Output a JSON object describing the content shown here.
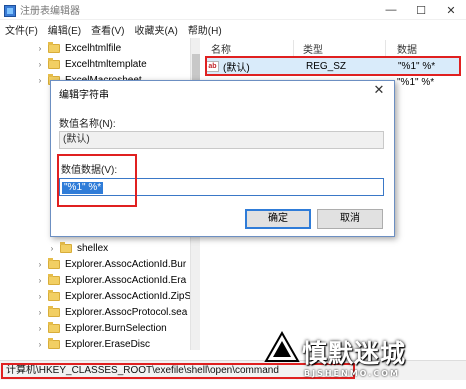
{
  "window": {
    "title": "注册表编辑器",
    "minimize": "—",
    "maximize": "☐",
    "close": "✕"
  },
  "menu": [
    "文件(F)",
    "编辑(E)",
    "查看(V)",
    "收藏夹(A)",
    "帮助(H)"
  ],
  "tree": {
    "items": [
      {
        "label": "Excelhtmlfile",
        "expander": "›"
      },
      {
        "label": "Excelhtmltemplate",
        "expander": "›"
      },
      {
        "label": "ExcelMacrosheet",
        "expander": "›"
      },
      {
        "label": "shellex",
        "expander": "›"
      },
      {
        "label": "Explorer.AssocActionId.Bur",
        "expander": "›"
      },
      {
        "label": "Explorer.AssocActionId.Era",
        "expander": "›"
      },
      {
        "label": "Explorer.AssocActionId.ZipS",
        "expander": "›"
      },
      {
        "label": "Explorer.AssocProtocol.sea",
        "expander": "›"
      },
      {
        "label": "Explorer.BurnSelection",
        "expander": "›"
      },
      {
        "label": "Explorer.EraseDisc",
        "expander": "›"
      }
    ]
  },
  "values": {
    "headers": {
      "name": "名称",
      "type": "类型",
      "data": "数据"
    },
    "rows": [
      {
        "icon": "ab",
        "name": "(默认)",
        "type": "REG_SZ",
        "data": "\"%1\" %*"
      },
      {
        "icon": "ab",
        "name": "",
        "type": "",
        "data": "\"%1\" %*"
      }
    ]
  },
  "dialog": {
    "title": "编辑字符串",
    "close": "✕",
    "name_label": "数值名称(N):",
    "name_value": "(默认)",
    "data_label": "数值数据(V):",
    "data_value": "\"%1\" %*",
    "ok": "确定",
    "cancel": "取消"
  },
  "status": {
    "path": "计算机\\HKEY_CLASSES_ROOT\\exefile\\shell\\open\\command"
  },
  "watermark": {
    "title": "慎默迷城",
    "subtitle": "BJSHENMO.COM"
  },
  "colors": {
    "highlight_box": "#e02020",
    "selection": "#2f7cd8",
    "folder": "#f2cf63"
  }
}
